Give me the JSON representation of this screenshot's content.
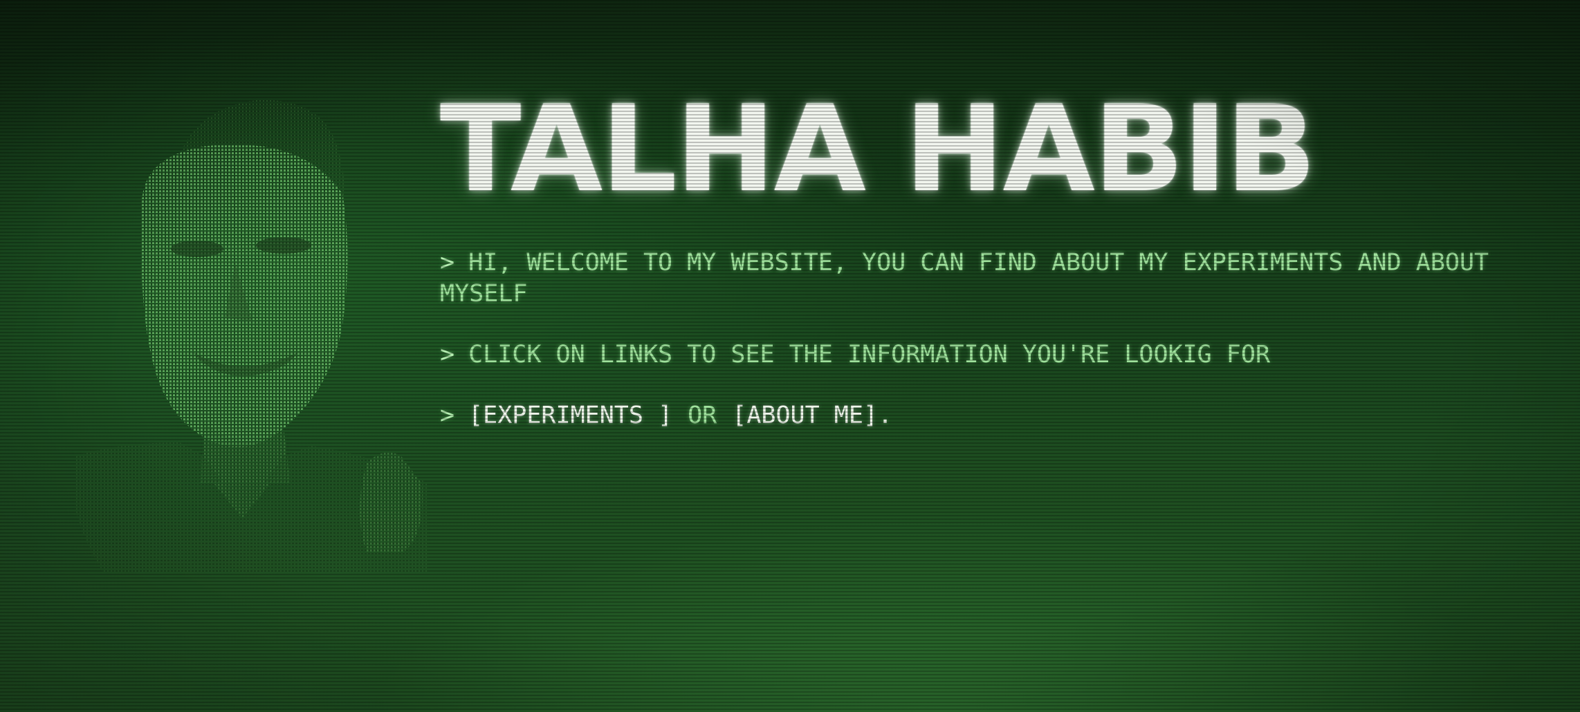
{
  "header": {
    "title": "TALHA HABIB"
  },
  "intro": {
    "prompt_symbol": ">",
    "line1": "HI, WELCOME TO MY WEBSITE, YOU CAN FIND ABOUT MY EXPERIMENTS AND ABOUT MYSELF",
    "line2": "CLICK ON LINKS TO SEE THE INFORMATION YOU'RE LOOKIG FOR"
  },
  "links": {
    "experiments_label": "[EXPERIMENTS ]",
    "separator": "OR",
    "about_label": "[ABOUT ME]",
    "trailing": "."
  },
  "portrait": {
    "icon": "ascii-portrait",
    "color": "#5fb85c"
  },
  "colors": {
    "background": "#1d4d21",
    "text_green": "#9fe29c",
    "title_white": "#f2f6ef"
  }
}
